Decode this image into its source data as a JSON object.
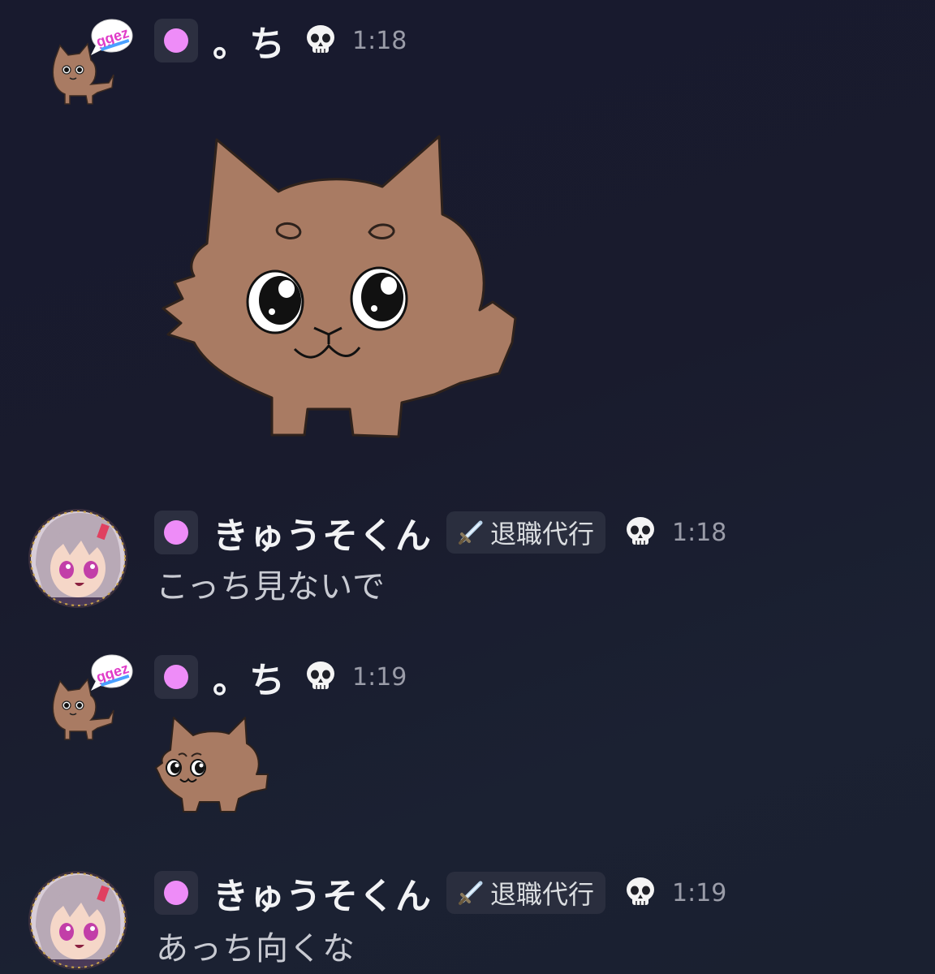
{
  "messages": [
    {
      "author": "。ち",
      "time": "1:18",
      "avatar": "dog-avatar-ggez",
      "avatar_badge_text": "ggez",
      "attachment": "dog-sticker-large",
      "role_color": "#ee8cf8"
    },
    {
      "author": "きゅうそくん",
      "time": "1:18",
      "avatar": "anime-girl-avatar",
      "tag_icon": "sword-icon",
      "tag": "退職代行",
      "text": "こっち見ないで",
      "role_color": "#ee8cf8"
    },
    {
      "author": "。ち",
      "time": "1:19",
      "avatar": "dog-avatar-ggez",
      "avatar_badge_text": "ggez",
      "attachment": "dog-emoji-small",
      "role_color": "#ee8cf8"
    },
    {
      "author": "きゅうそくん",
      "time": "1:19",
      "avatar": "anime-girl-avatar",
      "tag_icon": "sword-icon",
      "tag": "退職代行",
      "text": "あっち向くな",
      "role_color": "#ee8cf8"
    }
  ],
  "status_icon": "skull-icon"
}
